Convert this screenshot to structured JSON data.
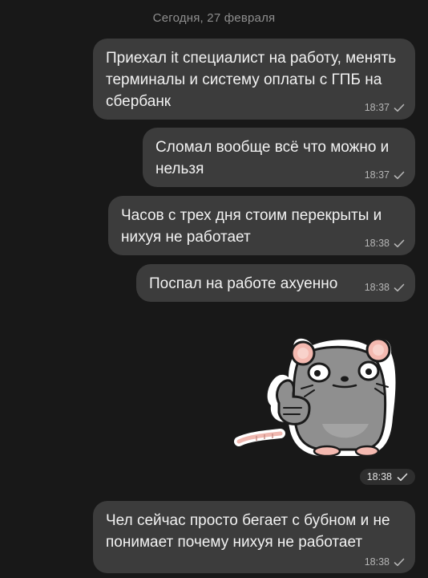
{
  "chat": {
    "date_separator": "Сегодня, 27 февраля",
    "messages": [
      {
        "text": "Приехал it специалист на работу, менять терминалы и систему оплаты с ГПБ на сбербанк",
        "time": "18:37",
        "status_icon": "single-check-icon"
      },
      {
        "text": "Сломал вообще всё что можно и нельзя",
        "time": "18:37",
        "status_icon": "single-check-icon"
      },
      {
        "text": "Часов с трех дня стоим перекрыты и нихуя не работает",
        "time": "18:38",
        "status_icon": "single-check-icon"
      },
      {
        "text": "Поспал на работе ахуенно",
        "time": "18:38",
        "status_icon": "single-check-icon"
      },
      {
        "type": "sticker",
        "sticker": "rat-thumbs-up-sticker",
        "time": "18:38",
        "status_icon": "single-check-icon"
      },
      {
        "text": "Чел сейчас просто бегает с бубном и не понимает почему нихуя не работает",
        "time": "18:38",
        "status_icon": "single-check-icon"
      }
    ]
  },
  "colors": {
    "background": "#181818",
    "bubble": "#3c3c3c",
    "text": "#f2f2f2",
    "meta_text": "#b5b5b5",
    "date_text": "#8e8e8e"
  }
}
